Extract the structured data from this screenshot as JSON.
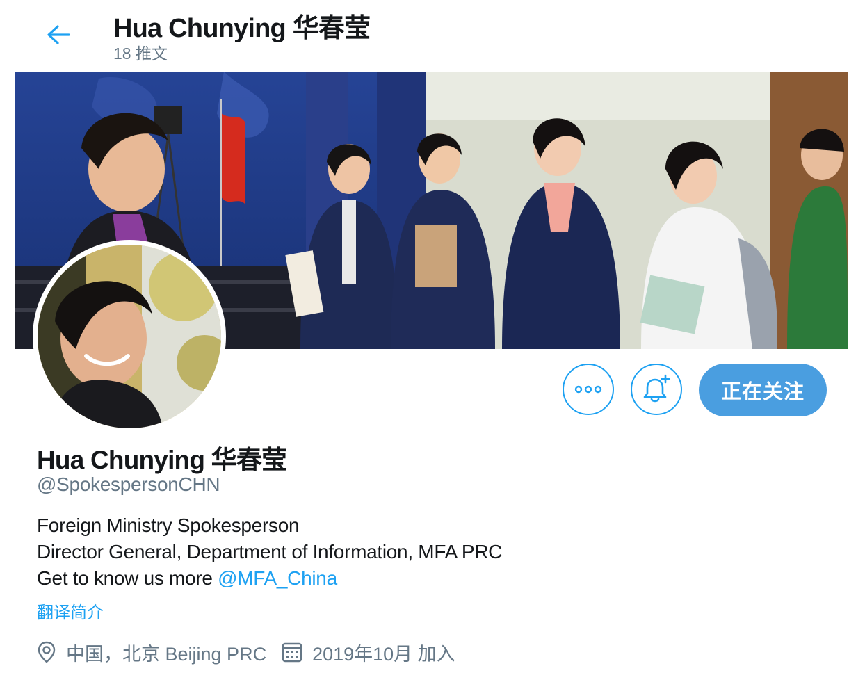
{
  "header": {
    "title": "Hua Chunying 华春莹",
    "tweet_count": "18 推文"
  },
  "profile": {
    "name": "Hua Chunying 华春莹",
    "handle": "@SpokespersonCHN",
    "bio_line1": "Foreign Ministry Spokesperson",
    "bio_line2": "Director General, Department of Information, MFA PRC",
    "bio_line3_prefix": "Get to know us more ",
    "bio_mention": "@MFA_China",
    "translate_label": "翻译简介",
    "location": "中国，北京 Beijing PRC",
    "joined": "2019年10月 加入"
  },
  "actions": {
    "follow_label": "正在关注"
  },
  "colors": {
    "accent": "#1da1f2",
    "follow_bg": "#4a9ee0",
    "secondary_text": "#657786"
  },
  "icons": {
    "back": "arrow-left-icon",
    "more": "more-dots-icon",
    "notify": "bell-plus-icon",
    "location": "map-pin-icon",
    "joined": "calendar-icon"
  }
}
